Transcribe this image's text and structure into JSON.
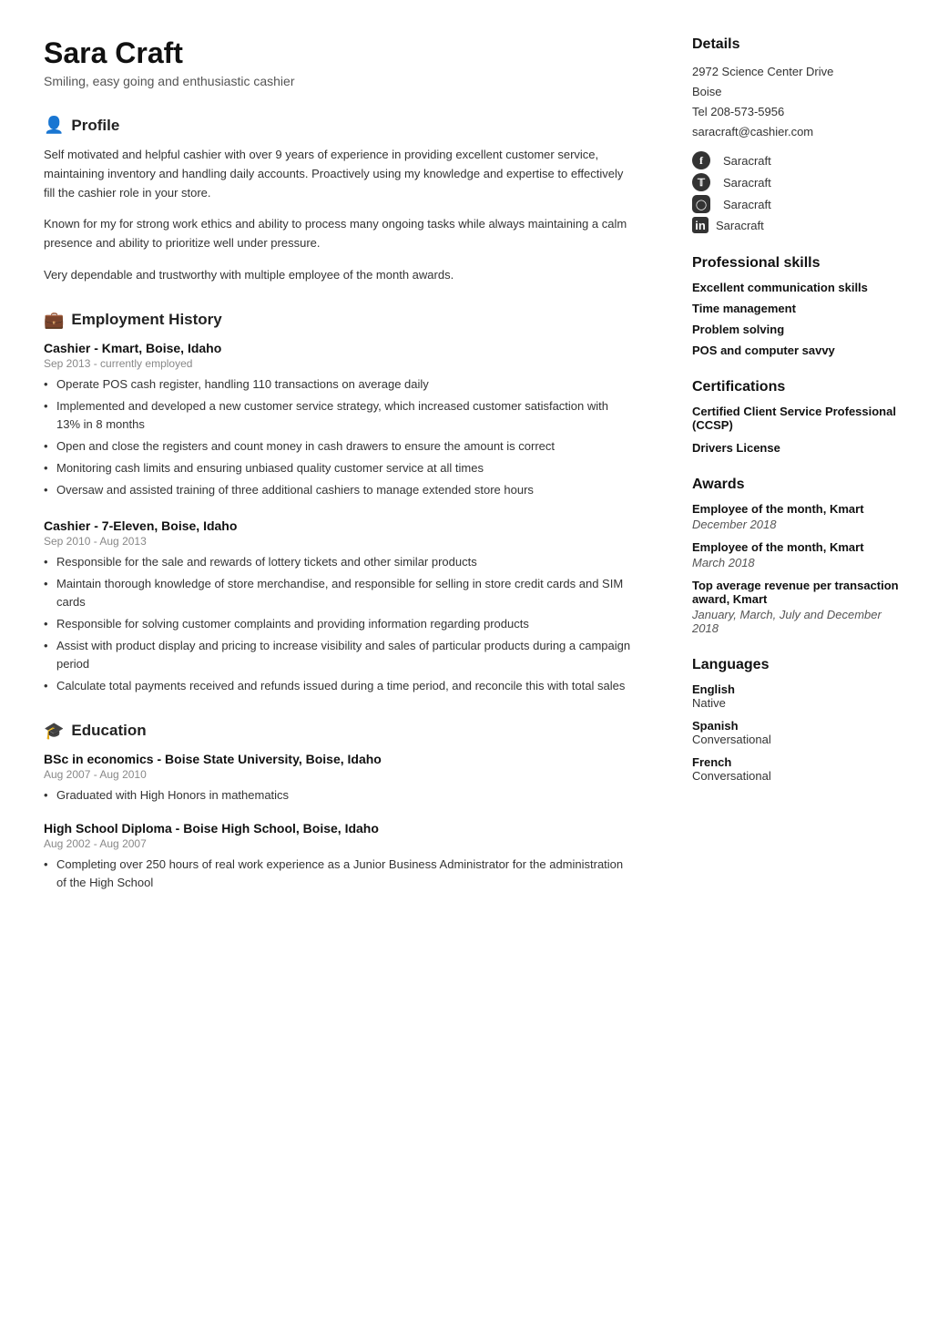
{
  "header": {
    "name": "Sara Craft",
    "subtitle": "Smiling, easy going and enthusiastic cashier"
  },
  "profile": {
    "section_title": "Profile",
    "paragraphs": [
      "Self motivated and helpful cashier with over 9 years of experience in providing excellent customer service, maintaining inventory and handling daily accounts. Proactively using my knowledge and expertise to effectively fill the cashier role in your store.",
      "Known for my for strong work ethics and ability to process many ongoing tasks while always maintaining a calm presence and ability to prioritize well under pressure.",
      "Very dependable and trustworthy with multiple employee of the month awards."
    ]
  },
  "employment": {
    "section_title": "Employment History",
    "jobs": [
      {
        "title": "Cashier - Kmart, Boise, Idaho",
        "date": "Sep 2013 - currently employed",
        "bullets": [
          "Operate POS cash register, handling 110 transactions on average daily",
          "Implemented and developed a new customer service strategy, which increased customer satisfaction with 13% in 8 months",
          "Open and close the registers and count money in cash drawers to ensure the amount is correct",
          "Monitoring cash limits and ensuring unbiased quality customer service at all times",
          "Oversaw and assisted training of three additional cashiers to manage extended store hours"
        ]
      },
      {
        "title": "Cashier - 7-Eleven, Boise, Idaho",
        "date": "Sep 2010 - Aug 2013",
        "bullets": [
          "Responsible for the sale and rewards of lottery tickets and other similar products",
          "Maintain thorough knowledge of store merchandise, and responsible for selling in store credit cards and SIM cards",
          "Responsible for solving customer complaints and providing information regarding products",
          "Assist with product display and pricing to increase visibility and sales of particular products during a campaign period",
          "Calculate total payments received and refunds issued during a time period, and reconcile this with total sales"
        ]
      }
    ]
  },
  "education": {
    "section_title": "Education",
    "entries": [
      {
        "title": "BSc in economics - Boise State University, Boise, Idaho",
        "date": "Aug 2007 - Aug 2010",
        "bullets": [
          "Graduated with High Honors in mathematics"
        ]
      },
      {
        "title": "High School Diploma - Boise High School, Boise, Idaho",
        "date": "Aug 2002 - Aug 2007",
        "bullets": [
          "Completing over 250 hours of real work experience as a Junior Business Administrator for the administration of the High School"
        ]
      }
    ]
  },
  "details": {
    "section_title": "Details",
    "address": "2972 Science Center Drive",
    "city": "Boise",
    "tel": "Tel 208-573-5956",
    "email": "saracraft@cashier.com",
    "socials": [
      {
        "icon": "facebook",
        "label": "Saracraft"
      },
      {
        "icon": "twitter",
        "label": "Saracraft"
      },
      {
        "icon": "instagram",
        "label": "Saracraft"
      },
      {
        "icon": "linkedin",
        "label": "Saracraft"
      }
    ]
  },
  "skills": {
    "section_title": "Professional skills",
    "items": [
      "Excellent communication skills",
      "Time management",
      "Problem solving",
      "POS and computer savvy"
    ]
  },
  "certifications": {
    "section_title": "Certifications",
    "items": [
      "Certified Client Service Professional (CCSP)",
      "Drivers License"
    ]
  },
  "awards": {
    "section_title": "Awards",
    "items": [
      {
        "title": "Employee of the month, Kmart",
        "date": "December 2018"
      },
      {
        "title": "Employee of the month, Kmart",
        "date": "March 2018"
      },
      {
        "title": "Top average revenue per transaction award, Kmart",
        "date": "January, March, July and December 2018"
      }
    ]
  },
  "languages": {
    "section_title": "Languages",
    "items": [
      {
        "name": "English",
        "level": "Native"
      },
      {
        "name": "Spanish",
        "level": "Conversational"
      },
      {
        "name": "French",
        "level": "Conversational"
      }
    ]
  }
}
